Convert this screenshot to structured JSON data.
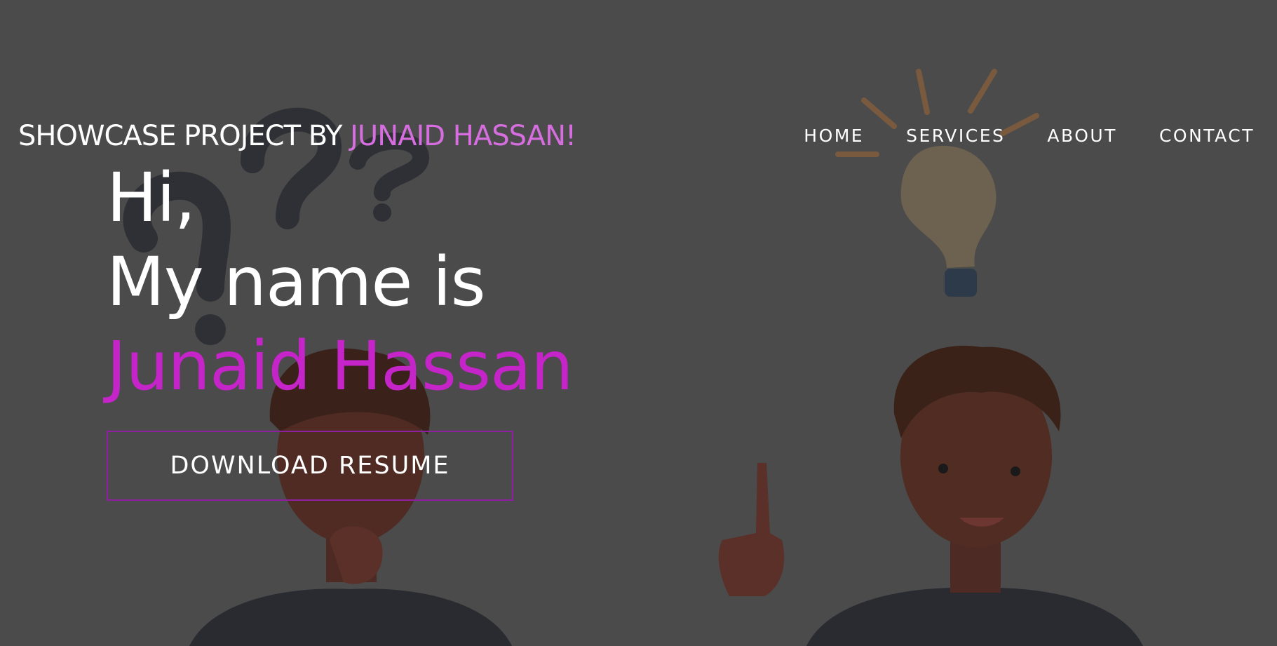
{
  "header": {
    "logo_prefix": "SHOWCASE PROJECT BY ",
    "logo_accent": "JUNAID HASSAN!",
    "nav": [
      {
        "label": "HOME"
      },
      {
        "label": "SERVICES"
      },
      {
        "label": "ABOUT"
      },
      {
        "label": "CONTACT"
      }
    ]
  },
  "hero": {
    "greeting": "Hi,",
    "intro": "My name is",
    "name": "Junaid Hassan",
    "cta_label": "DOWNLOAD RESUME"
  },
  "colors": {
    "overlay_bg": "#4b4b4b",
    "accent_logo": "#d66ee0",
    "accent_name": "#c424c8",
    "button_border": "#8e1fa0",
    "text": "#ffffff"
  },
  "illustration": {
    "elements": [
      "question-marks",
      "light-bulb-icon",
      "thinking-person",
      "idea-person"
    ]
  }
}
